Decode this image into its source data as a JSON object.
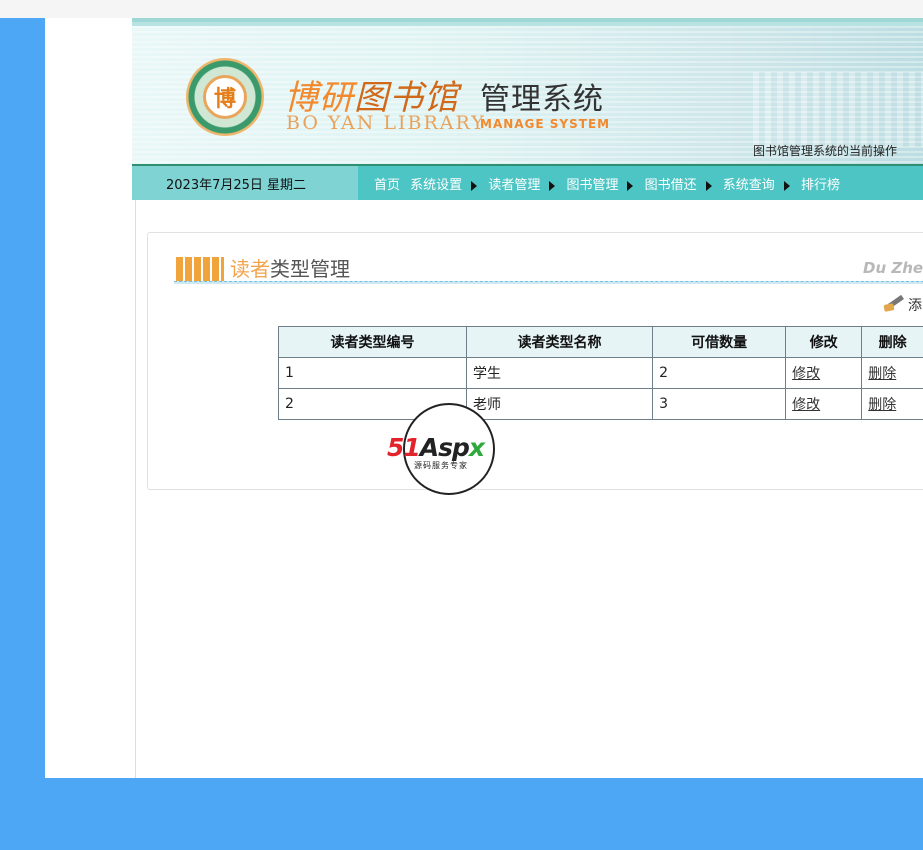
{
  "header": {
    "logo_text": "博",
    "brand_cn_a": "博研",
    "brand_cn_b": "图书馆",
    "brand_manage": "管理系统",
    "brand_en": "BO YAN LIBRARY",
    "brand_en_bold": "MANAGE SYSTEM",
    "op_hint": "图书馆管理系统的当前操作"
  },
  "navbar": {
    "date": "2023年7月25日",
    "weekday": "星期二",
    "menu": [
      "首页",
      "系统设置",
      "读者管理",
      "图书管理",
      "图书借还",
      "系统查询",
      "排行榜"
    ]
  },
  "panel": {
    "title_a": "读者",
    "title_b": "类型管理",
    "title_en": "Du Zhe Lei",
    "add_label": "添"
  },
  "table": {
    "headers": [
      "读者类型编号",
      "读者类型名称",
      "可借数量",
      "修改",
      "删除"
    ],
    "rows": [
      [
        "1",
        "学生",
        "2",
        "修改",
        "删除"
      ],
      [
        "2",
        "老师",
        "3",
        "修改",
        "删除"
      ]
    ]
  },
  "watermark": {
    "brand_a": "51",
    "brand_b": "Asp",
    "brand_c": "x",
    "sub": "源码服务专家"
  },
  "colors": {
    "page_blue": "#4da7f4",
    "nav_teal": "#4ec5c5",
    "date_box": "#7fd3d3",
    "brand_orange": "#f28a2d"
  }
}
